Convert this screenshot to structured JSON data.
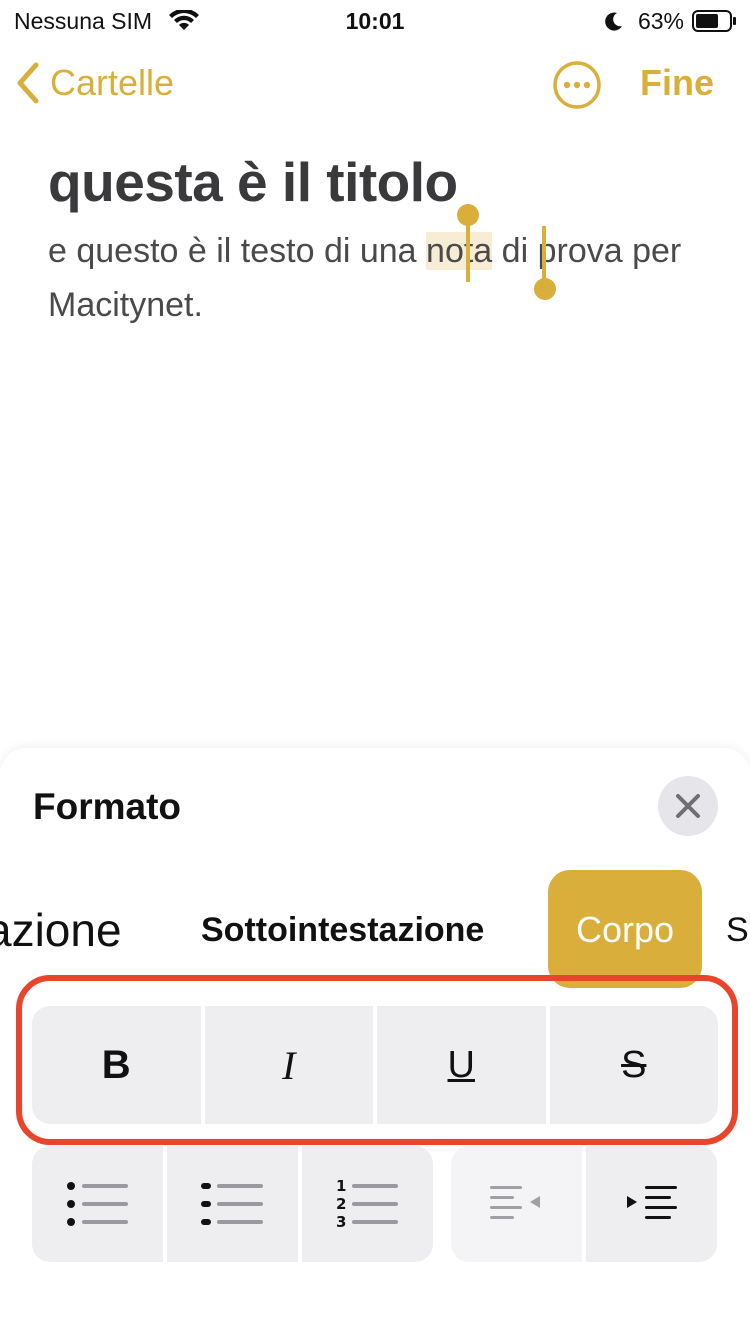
{
  "status_bar": {
    "carrier": "Nessuna SIM",
    "time": "10:01",
    "battery": "63%"
  },
  "nav": {
    "back_label": "Cartelle",
    "done_label": "Fine",
    "accent_color": "#d9ae3b"
  },
  "note": {
    "title": "questa è il titolo",
    "body_before": "e questo è il testo di una ",
    "body_selected": "nota",
    "body_after": " di prova per Macitynet."
  },
  "format_sheet": {
    "title": "Formato",
    "styles": [
      "azione",
      "Sottointestazione",
      "Corpo",
      "S"
    ],
    "selected_style": "Corpo",
    "text_buttons": [
      "B",
      "I",
      "U",
      "S"
    ],
    "highlight_color": "#e8452c",
    "icons": {
      "close": "close-icon",
      "bullet_list": "bulleted-list-icon",
      "dashed_list": "dashed-list-icon",
      "numbered_list": "numbered-list-icon",
      "outdent": "outdent-icon",
      "indent": "indent-icon"
    }
  }
}
